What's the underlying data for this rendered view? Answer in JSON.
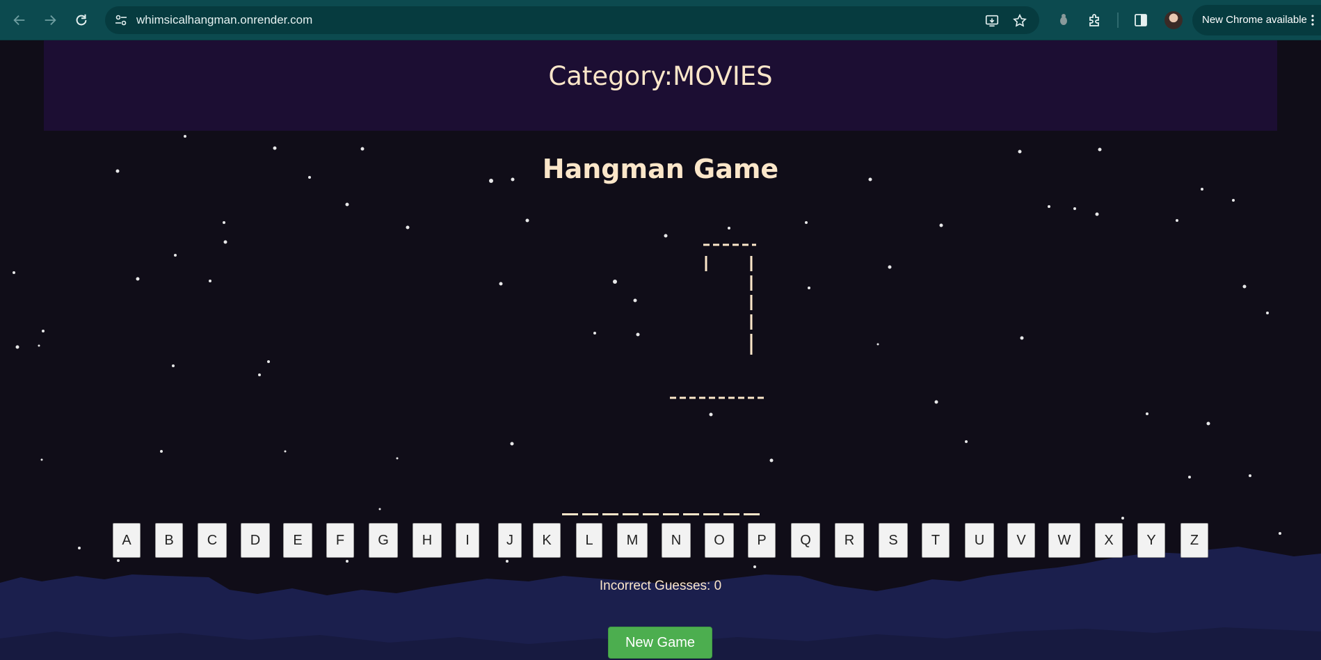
{
  "browser": {
    "url": "whimsicalhangman.onrender.com",
    "update_label": "New Chrome available",
    "icons": [
      "back-icon",
      "forward-icon",
      "reload-icon",
      "site-settings-icon",
      "install-app-icon",
      "bookmark-star-icon",
      "extension-icon",
      "puzzle-extensions-icon",
      "side-panel-icon",
      "avatar",
      "more-menu-icon"
    ]
  },
  "header": {
    "category": "Category:MOVIES"
  },
  "game": {
    "title": "Hangman Game",
    "word_length": 10,
    "letters": [
      "A",
      "B",
      "C",
      "D",
      "E",
      "F",
      "G",
      "H",
      "I",
      "J",
      "K",
      "L",
      "M",
      "N",
      "O",
      "P",
      "Q",
      "R",
      "S",
      "T",
      "U",
      "V",
      "W",
      "X",
      "Y",
      "Z"
    ],
    "incorrect_guesses": "Incorrect Guesses: 0",
    "new_game_label": "New Game"
  },
  "colors": {
    "chrome_bg": "#0c4a4f",
    "page_bg": "#100d18",
    "header_band": "#1c0e33",
    "text_cream": "#fbe6c9",
    "button_green": "#4cae4f",
    "mountain": "#1b1f4d"
  }
}
